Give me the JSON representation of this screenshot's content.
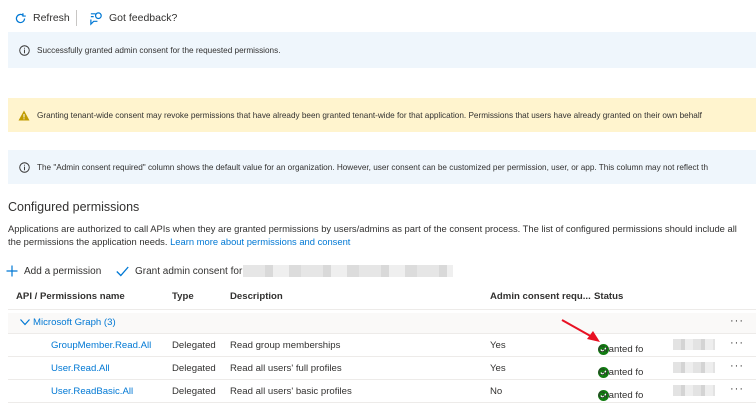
{
  "toolbar": {
    "refresh_label": "Refresh",
    "feedback_label": "Got feedback?"
  },
  "banners": {
    "success": "Successfully granted admin consent for the requested permissions.",
    "warning": "Granting tenant-wide consent may revoke permissions that have already been granted tenant-wide for that application. Permissions that users have already granted on their own behalf",
    "info": "The \"Admin consent required\" column shows the default value for an organization. However, user consent can be customized per permission, user, or app. This column may not reflect th"
  },
  "section": {
    "title": "Configured permissions",
    "description": "Applications are authorized to call APIs when they are granted permissions by users/admins as part of the consent process. The list of configured permissions should include all the permissions the application needs.",
    "learn_more_link": "Learn more about permissions and consent"
  },
  "actions": {
    "add_permission": "Add a permission",
    "grant_admin_consent": "Grant admin consent for"
  },
  "table": {
    "headers": {
      "api": "API / Permissions name",
      "type": "Type",
      "description": "Description",
      "admin_consent": "Admin consent requ...",
      "status": "Status"
    },
    "group": {
      "label": "Microsoft Graph (3)",
      "more": "···"
    },
    "rows": [
      {
        "name": "GroupMember.Read.All",
        "type": "Delegated",
        "description": "Read group memberships",
        "admin_consent": "Yes",
        "status": "Granted fo",
        "more": "···"
      },
      {
        "name": "User.Read.All",
        "type": "Delegated",
        "description": "Read all users' full profiles",
        "admin_consent": "Yes",
        "status": "Granted fo",
        "more": "···"
      },
      {
        "name": "User.ReadBasic.All",
        "type": "Delegated",
        "description": "Read all users' basic profiles",
        "admin_consent": "No",
        "status": "Granted fo",
        "more": "···"
      }
    ]
  },
  "colors": {
    "accent": "#0078d4",
    "success_green": "#107c10",
    "warning_icon": "#c19c00",
    "annotation_arrow": "#e81123"
  }
}
